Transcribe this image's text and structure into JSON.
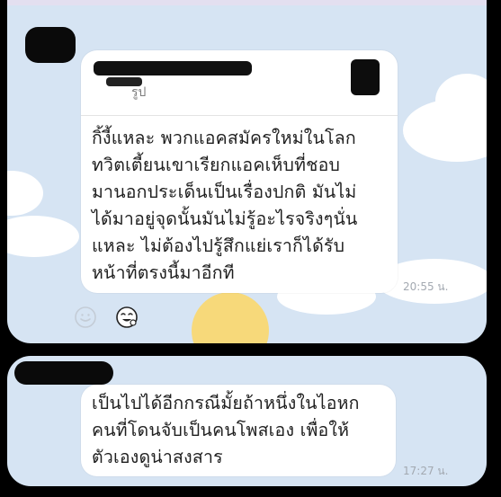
{
  "messages": [
    {
      "reply_preview": {
        "type_label": "รูป"
      },
      "text": "กิ้งี้แหละ พวกแอคสมัครใหม่ในโลก\nทวิตเตี้ยนเขาเรียกแอคเห็บที่ชอบ\nมานอกประเด็นเป็นเรื่องปกติ มันไม่\nได้มาอยู่จุดนั้นมันไม่รู้อะไรจริงๆนั่น\nแหละ ไม่ต้องไปรู้สึกแย่เราก็ได้รับ\nหน้าที่ตรงนี้มาอีกที",
      "time": "20:55 น."
    },
    {
      "text": "เป็นไปได้อีกกรณีมั้ยถ้าหนึ่งในไอหก\nคนที่โดนจับเป็นคนโพสเอง เพื่อให้\nตัวเองดูน่าสงสาร",
      "time": "17:27 น."
    }
  ],
  "icons": {
    "reaction": "smiley-outline-icon",
    "sticker": "emoji-sticker-icon"
  },
  "colors": {
    "chat_background": "#d6e4f3",
    "bubble": "#ffffff",
    "text": "#1f1f1f",
    "timestamp": "#a3a9b1",
    "outer_background": "#000000"
  }
}
